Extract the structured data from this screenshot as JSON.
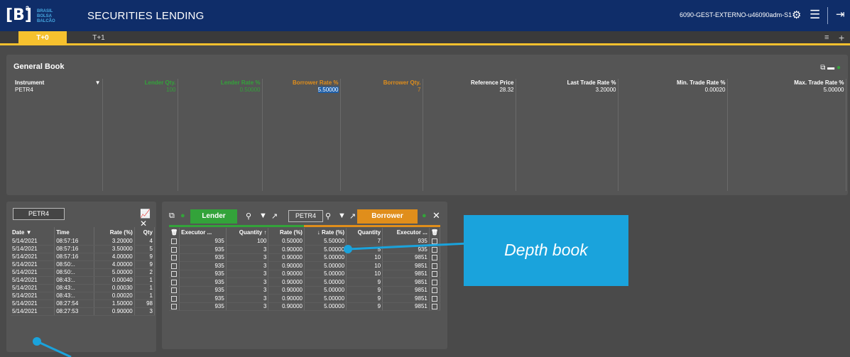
{
  "header": {
    "logo_mark": "[B]",
    "logo_sup": "3",
    "logo_sub": [
      "BRASIL",
      "BOLSA",
      "BALCÃO"
    ],
    "title": "SECURITIES LENDING",
    "user": "6090-GEST-EXTERNO-u46090adm-S1"
  },
  "tabs": [
    {
      "label": "T+0",
      "active": true
    },
    {
      "label": "T+1",
      "active": false
    }
  ],
  "general_book": {
    "title": "General Book",
    "columns": [
      "Instrument",
      "Lender Qty.",
      "Lender Rate %",
      "Borrower Rate %",
      "Borrower Qty.",
      "Reference Price",
      "Last Trade Rate %",
      "Min. Trade Rate %",
      "Max. Trade Rate %"
    ],
    "row": [
      "PETR4",
      "100",
      "0.50000",
      "5.50000",
      "7",
      "28.32",
      "3.20000",
      "0.00020",
      "5.00000"
    ]
  },
  "trades": {
    "instrument": "PETR4",
    "columns": [
      "Date",
      "Time",
      "Rate (%)",
      "Qty"
    ],
    "rows": [
      [
        "5/14/2021",
        "08:57:16",
        "3.20000",
        "4"
      ],
      [
        "5/14/2021",
        "08:57:16",
        "3.50000",
        "5"
      ],
      [
        "5/14/2021",
        "08:57:16",
        "4.00000",
        "9"
      ],
      [
        "5/14/2021",
        "08:50:..",
        "4.00000",
        "9"
      ],
      [
        "5/14/2021",
        "08:50:..",
        "5.00000",
        "2"
      ],
      [
        "5/14/2021",
        "08:43:..",
        "0.00040",
        "1"
      ],
      [
        "5/14/2021",
        "08:43:..",
        "0.00030",
        "1"
      ],
      [
        "5/14/2021",
        "08:43:..",
        "0.00020",
        "1"
      ],
      [
        "5/14/2021",
        "08:27:54",
        "1.50000",
        "98"
      ],
      [
        "5/14/2021",
        "08:27:53",
        "0.90000",
        "3"
      ]
    ]
  },
  "depth": {
    "lender_label": "Lender",
    "borrower_label": "Borrower",
    "instrument": "PETR4",
    "columns": [
      "Executor ...",
      "Quantity",
      "Rate (%)",
      "Rate (%)",
      "Quantity",
      "Executor ..."
    ],
    "rows": [
      [
        "935",
        "100",
        "0.50000",
        "5.50000",
        "7",
        "935"
      ],
      [
        "935",
        "3",
        "0.90000",
        "5.00000",
        "5",
        "935"
      ],
      [
        "935",
        "3",
        "0.90000",
        "5.00000",
        "10",
        "9851"
      ],
      [
        "935",
        "3",
        "0.90000",
        "5.00000",
        "10",
        "9851"
      ],
      [
        "935",
        "3",
        "0.90000",
        "5.00000",
        "10",
        "9851"
      ],
      [
        "935",
        "3",
        "0.90000",
        "5.00000",
        "9",
        "9851"
      ],
      [
        "935",
        "3",
        "0.90000",
        "5.00000",
        "9",
        "9851"
      ],
      [
        "935",
        "3",
        "0.90000",
        "5.00000",
        "9",
        "9851"
      ],
      [
        "935",
        "3",
        "0.90000",
        "5.00000",
        "9",
        "9851"
      ]
    ]
  },
  "callout": {
    "text": "Depth book"
  },
  "colors": {
    "header": "#0f2d69",
    "accent": "#f6c12e",
    "lender": "#33a33a",
    "borrower": "#e08e1b",
    "callout": "#1aa3dc"
  }
}
